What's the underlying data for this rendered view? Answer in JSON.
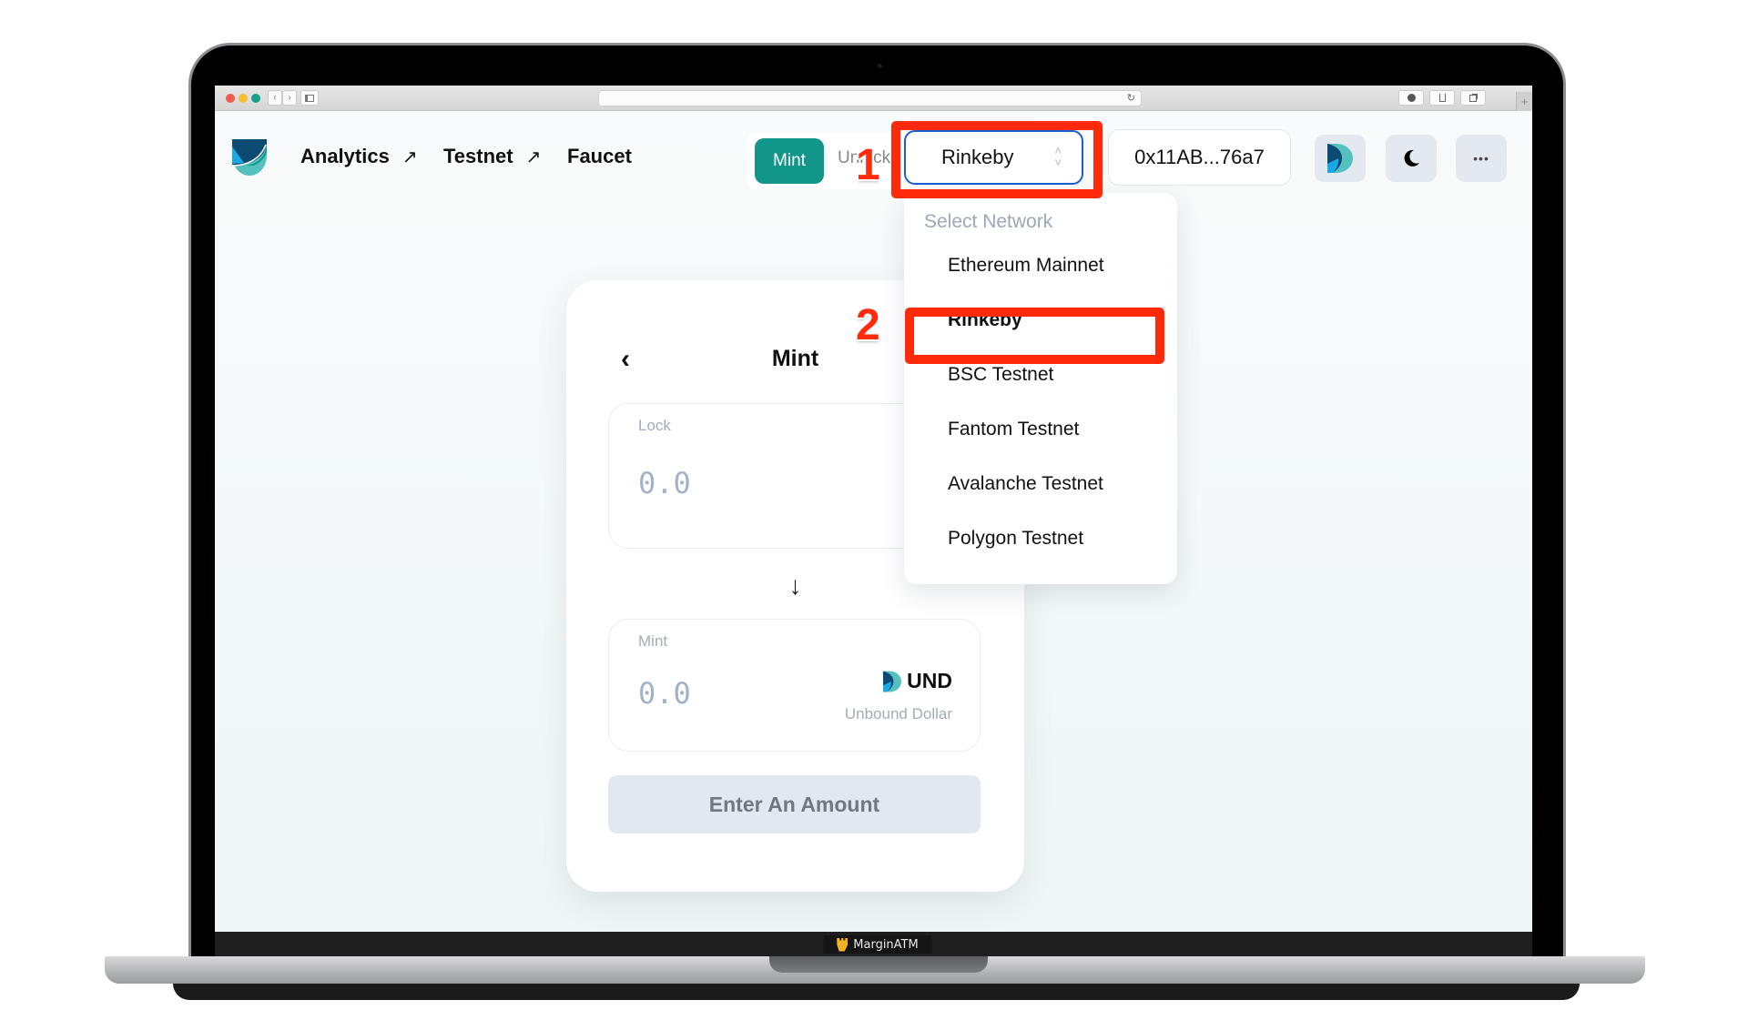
{
  "browser": {
    "nav_back_glyph": "‹",
    "nav_forward_glyph": "›",
    "reload_glyph": "↻",
    "new_tab_glyph": "+"
  },
  "nav": {
    "links": [
      {
        "label": "Analytics",
        "external": true,
        "arrow": "↗"
      },
      {
        "label": "Testnet",
        "external": true,
        "arrow": "↗"
      },
      {
        "label": "Faucet",
        "external": false,
        "arrow": ""
      }
    ]
  },
  "mode_tabs": {
    "items": [
      {
        "label": "Mint",
        "active": true
      },
      {
        "label": "Unlock",
        "active": false
      }
    ]
  },
  "network_select": {
    "value": "Rinkeby",
    "options_header": "Select Network",
    "options": [
      {
        "label": "Ethereum Mainnet",
        "selected": false
      },
      {
        "label": "Rinkeby",
        "selected": true
      },
      {
        "label": "BSC Testnet",
        "selected": false
      },
      {
        "label": "Fantom Testnet",
        "selected": false
      },
      {
        "label": "Avalanche Testnet",
        "selected": false
      },
      {
        "label": "Polygon Testnet",
        "selected": false
      }
    ]
  },
  "wallet": {
    "address": "0x11AB...76a7"
  },
  "header_icons": [
    "und-logo-icon",
    "moon-icon",
    "more-icon"
  ],
  "more_glyph": "•••",
  "moon_glyph": "☾",
  "card": {
    "back_glyph": "‹",
    "title": "Mint",
    "lock": {
      "label": "Lock",
      "placeholder": "0.0",
      "token_icon": "ethereum-icon"
    },
    "arrow_glyph": "↓",
    "mint": {
      "label": "Mint",
      "placeholder": "0.0",
      "token_symbol": "UND",
      "token_name": "Unbound Dollar"
    },
    "submit_label": "Enter An Amount"
  },
  "annotations": [
    {
      "number": "1",
      "target": "network-select"
    },
    {
      "number": "2",
      "target": "network-option-rinkeby"
    }
  ],
  "dock_brand": "MarginATM",
  "colors": {
    "accent": "#12968a",
    "select_border": "#1a5fd1",
    "annotation": "#ff2a0a",
    "cta_bg": "#e2e8f0"
  }
}
